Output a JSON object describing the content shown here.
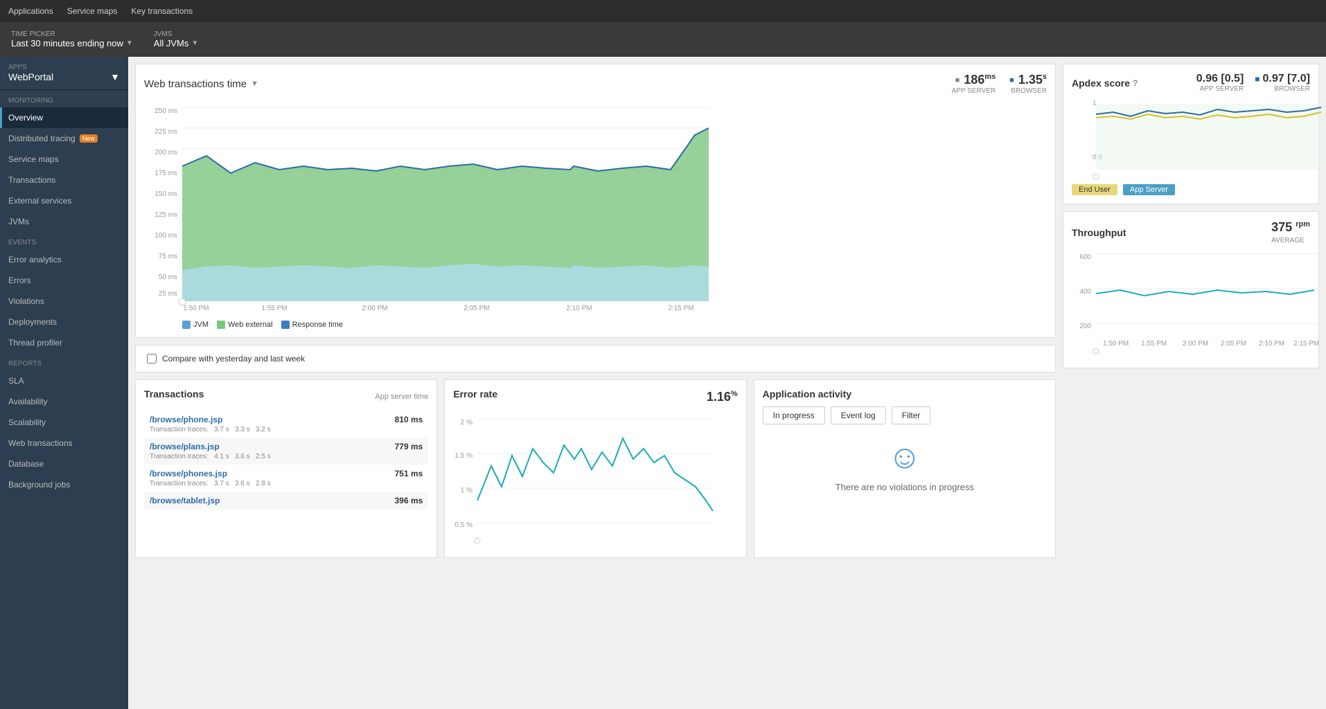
{
  "topNav": {
    "items": [
      "Applications",
      "Service maps",
      "Key transactions"
    ]
  },
  "subHeader": {
    "timePicker": {
      "label": "TIME PICKER",
      "value": "Last 30 minutes ending now"
    },
    "jvms": {
      "label": "JVMS",
      "value": "All JVMs"
    }
  },
  "sidebar": {
    "apps": {
      "label": "APPS",
      "name": "WebPortal"
    },
    "monitoring": {
      "label": "MONITORING",
      "items": [
        {
          "id": "overview",
          "label": "Overview",
          "active": true
        },
        {
          "id": "distributed-tracing",
          "label": "Distributed tracing",
          "badge": "New"
        },
        {
          "id": "service-maps",
          "label": "Service maps"
        },
        {
          "id": "transactions",
          "label": "Transactions"
        },
        {
          "id": "external-services",
          "label": "External services"
        },
        {
          "id": "jvms",
          "label": "JVMs"
        }
      ]
    },
    "events": {
      "label": "EVENTS",
      "items": [
        {
          "id": "error-analytics",
          "label": "Error analytics"
        },
        {
          "id": "errors",
          "label": "Errors"
        },
        {
          "id": "violations",
          "label": "Violations"
        },
        {
          "id": "deployments",
          "label": "Deployments"
        },
        {
          "id": "thread-profiler",
          "label": "Thread profiler"
        }
      ]
    },
    "reports": {
      "label": "REPORTS",
      "items": [
        {
          "id": "sla",
          "label": "SLA"
        },
        {
          "id": "availability",
          "label": "Availability"
        },
        {
          "id": "scalability",
          "label": "Scalability"
        },
        {
          "id": "web-transactions",
          "label": "Web transactions"
        },
        {
          "id": "database",
          "label": "Database"
        },
        {
          "id": "background-jobs",
          "label": "Background jobs"
        }
      ]
    }
  },
  "webTransactionsChart": {
    "title": "Web transactions time",
    "appServer": {
      "value": "186",
      "unit": "ms",
      "label": "APP SERVER"
    },
    "browser": {
      "value": "1.35",
      "unit": "s",
      "label": "BROWSER"
    },
    "yLabels": [
      "250 ms",
      "225 ms",
      "200 ms",
      "175 ms",
      "150 ms",
      "125 ms",
      "100 ms",
      "75 ms",
      "50 ms",
      "25 ms"
    ],
    "xLabels": [
      "1:50 PM",
      "1:55 PM",
      "2:00 PM",
      "2:05 PM",
      "2:10 PM",
      "2:15 PM"
    ],
    "legend": [
      {
        "id": "jvm",
        "label": "JVM"
      },
      {
        "id": "web-external",
        "label": "Web external"
      },
      {
        "id": "response-time",
        "label": "Response time"
      }
    ]
  },
  "compareSection": {
    "label": "Compare with yesterday and last week"
  },
  "apdex": {
    "title": "Apdex score",
    "appServer": {
      "value": "0.96 [0.5]",
      "label": "APP SERVER"
    },
    "browser": {
      "value": "0.97 [7.0]",
      "label": "BROWSER"
    },
    "legend": [
      {
        "id": "end-user",
        "label": "End User",
        "class": "legend-enduser"
      },
      {
        "id": "app-server",
        "label": "App Server",
        "class": "legend-appserver"
      }
    ]
  },
  "throughput": {
    "title": "Throughput",
    "value": "375",
    "unit": "rpm",
    "label": "AVERAGE",
    "yLabels": [
      "600",
      "400",
      "200"
    ],
    "xLabels": [
      "1:50 PM",
      "1:55 PM",
      "2:00 PM",
      "2:05 PM",
      "2:10 PM",
      "2:15 PM"
    ]
  },
  "transactions": {
    "title": "Transactions",
    "subtitle": "App server time",
    "rows": [
      {
        "name": "/browse/phone.jsp",
        "time": "810 ms",
        "traces": "Transaction traces:   3.7 s   3.3 s   3.2 s"
      },
      {
        "name": "/browse/plans.jsp",
        "time": "779 ms",
        "traces": "Transaction traces:   4.1 s   3.6 s   2.5 s"
      },
      {
        "name": "/browse/phones.jsp",
        "time": "751 ms",
        "traces": "Transaction traces:   3.7 s   3.6 s   2.8 s"
      },
      {
        "name": "/browse/tablet.jsp",
        "time": "396 ms",
        "traces": ""
      }
    ]
  },
  "errorRate": {
    "title": "Error rate",
    "value": "1.16",
    "unit": "%",
    "yLabels": [
      "2 %",
      "1.5 %",
      "1 %",
      "0.5 %"
    ]
  },
  "applicationActivity": {
    "title": "Application activity",
    "buttons": [
      "In progress",
      "Event log",
      "Filter"
    ],
    "noViolationsText": "There are no violations in progress"
  }
}
